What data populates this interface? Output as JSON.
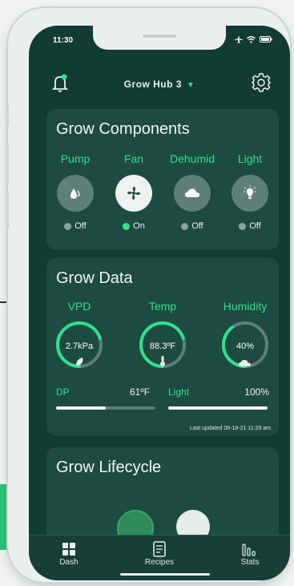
{
  "status_bar": {
    "time": "11:30"
  },
  "header": {
    "title": "Grow Hub 3",
    "dropdown_caret": "▼"
  },
  "components": {
    "title": "Grow Components",
    "items": [
      {
        "label": "Pump",
        "state": "Off",
        "on": false,
        "icon": "droplet-icon"
      },
      {
        "label": "Fan",
        "state": "On",
        "on": true,
        "icon": "fan-icon"
      },
      {
        "label": "Dehumid",
        "state": "Off",
        "on": false,
        "icon": "cloud-icon"
      },
      {
        "label": "Light",
        "state": "Off",
        "on": false,
        "icon": "lightbulb-icon"
      }
    ]
  },
  "grow_data": {
    "title": "Grow Data",
    "gauges": [
      {
        "label": "VPD",
        "value": "2.7kPa",
        "fraction": 0.7,
        "icon": "leaf-icon"
      },
      {
        "label": "Temp",
        "value": "88.3ºF",
        "fraction": 0.7,
        "icon": "thermometer-icon"
      },
      {
        "label": "Humidity",
        "value": "40%",
        "fraction": 0.4,
        "icon": "cloud-icon"
      }
    ],
    "dp": {
      "label": "DP",
      "value": "61ºF",
      "fraction": 0.5
    },
    "light": {
      "label": "Light",
      "value": "100%",
      "fraction": 1.0
    },
    "last_updated": "Last updated 06-18-21 11:29 am"
  },
  "lifecycle": {
    "title": "Grow Lifecycle"
  },
  "tabs": [
    {
      "label": "Dash",
      "icon": "grid-icon"
    },
    {
      "label": "Recipes",
      "icon": "document-icon"
    },
    {
      "label": "Stats",
      "icon": "bar-chart-icon"
    }
  ],
  "colors": {
    "background": "#123b33",
    "card": "#1d4a41",
    "accent": "#2fe08e"
  }
}
